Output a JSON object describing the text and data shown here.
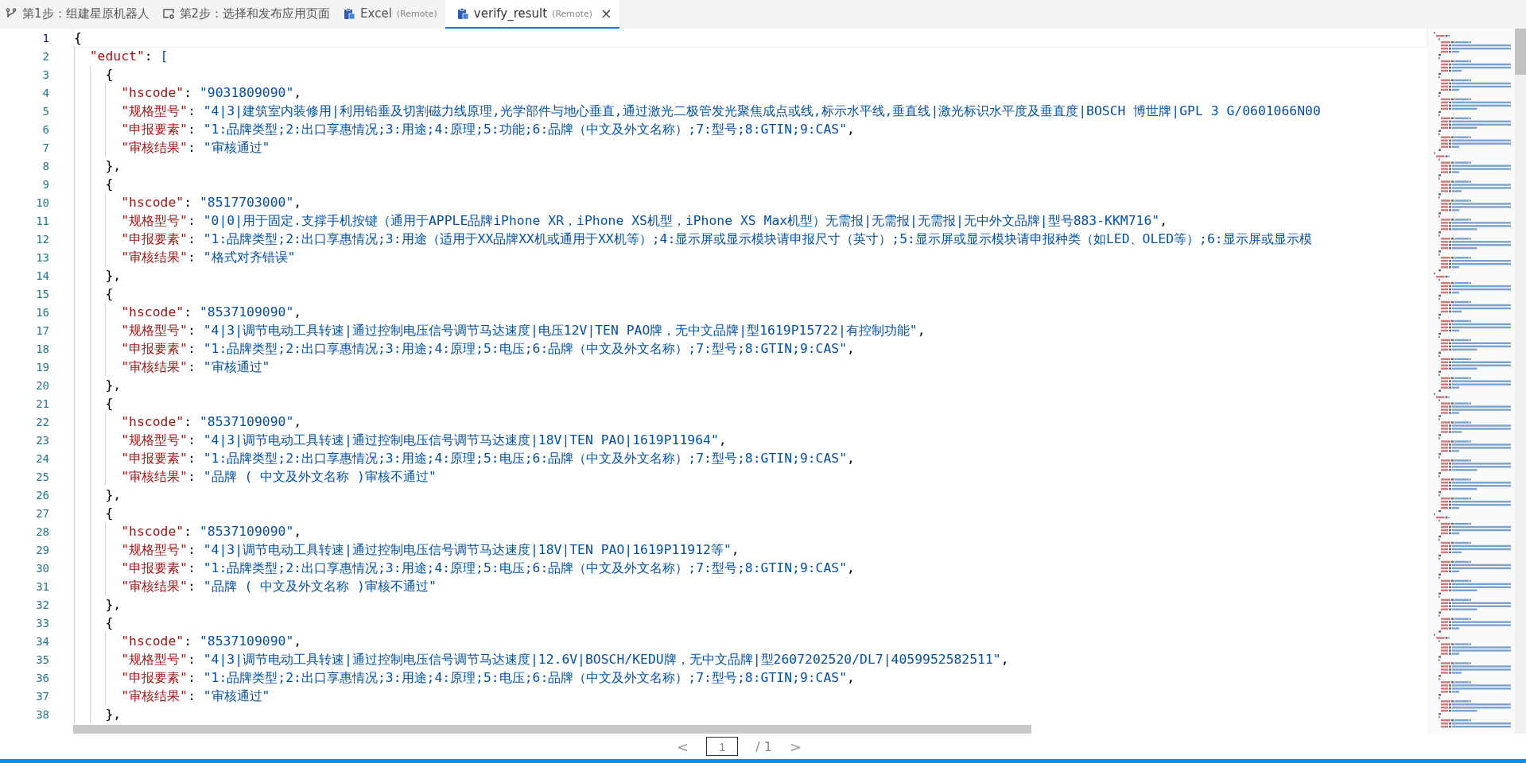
{
  "tabs": [
    {
      "label": "第1步：组建星原机器人",
      "selected": false
    },
    {
      "label": "第2步：选择和发布应用页面",
      "selected": false
    },
    {
      "label": "Excel",
      "suffix": "(Remote)",
      "selected": false
    },
    {
      "label": "verify_result",
      "suffix": "(Remote)",
      "selected": true,
      "close": "×"
    }
  ],
  "editor": {
    "lines": [
      {
        "number": "1",
        "active": true,
        "tokens": [
          {
            "kind": "punct",
            "text": "{"
          }
        ]
      },
      {
        "number": "2",
        "active": false,
        "tokens": [
          {
            "kind": "key",
            "text": "\"educt\""
          },
          {
            "kind": "punct",
            "text": ": "
          },
          {
            "kind": "str",
            "text": "["
          }
        ]
      },
      {
        "number": "3",
        "active": false,
        "tokens": [
          {
            "kind": "punct",
            "text": "{"
          }
        ]
      },
      {
        "number": "4",
        "active": false,
        "tokens": [
          {
            "kind": "key",
            "text": "\"hscode\""
          },
          {
            "kind": "punct",
            "text": ": "
          },
          {
            "kind": "str",
            "text": "\"9031809090\""
          },
          {
            "kind": "punct",
            "text": ","
          }
        ]
      },
      {
        "number": "5",
        "active": false,
        "tokens": [
          {
            "kind": "key",
            "text": "\"规格型号\""
          },
          {
            "kind": "punct",
            "text": ": "
          },
          {
            "kind": "str",
            "text": "\"4|3|建筑室内装修用|利用铅垂及切割磁力线原理,光学部件与地心垂直,通过激光二极管发光聚焦成点或线,标示水平线,垂直线|激光标识水平度及垂直度|BOSCH 博世牌|GPL 3 G/0601066N00"
          }
        ]
      },
      {
        "number": "6",
        "active": false,
        "tokens": [
          {
            "kind": "key",
            "text": "\"申报要素\""
          },
          {
            "kind": "punct",
            "text": ": "
          },
          {
            "kind": "str",
            "text": "\"1:品牌类型;2:出口享惠情况;3:用途;4:原理;5:功能;6:品牌（中文及外文名称）;7:型号;8:GTIN;9:CAS\""
          },
          {
            "kind": "punct",
            "text": ","
          }
        ]
      },
      {
        "number": "7",
        "active": false,
        "tokens": [
          {
            "kind": "key",
            "text": "\"审核结果\""
          },
          {
            "kind": "punct",
            "text": ": "
          },
          {
            "kind": "str",
            "text": "\"审核通过\""
          }
        ]
      },
      {
        "number": "8",
        "active": false,
        "tokens": [
          {
            "kind": "punct",
            "text": "},"
          }
        ]
      },
      {
        "number": "9",
        "active": false,
        "tokens": [
          {
            "kind": "punct",
            "text": "{"
          }
        ]
      },
      {
        "number": "10",
        "active": false,
        "tokens": [
          {
            "kind": "key",
            "text": "\"hscode\""
          },
          {
            "kind": "punct",
            "text": ": "
          },
          {
            "kind": "str",
            "text": "\"8517703000\""
          },
          {
            "kind": "punct",
            "text": ","
          }
        ]
      },
      {
        "number": "11",
        "active": false,
        "tokens": [
          {
            "kind": "key",
            "text": "\"规格型号\""
          },
          {
            "kind": "punct",
            "text": ": "
          },
          {
            "kind": "str",
            "text": "\"0|0|用于固定.支撑手机按键（通用于APPLE品牌iPhone XR，iPhone XS机型，iPhone XS Max机型）无需报|无需报|无需报|无中外文品牌|型号883-KKM716\""
          },
          {
            "kind": "punct",
            "text": ","
          }
        ]
      },
      {
        "number": "12",
        "active": false,
        "tokens": [
          {
            "kind": "key",
            "text": "\"申报要素\""
          },
          {
            "kind": "punct",
            "text": ": "
          },
          {
            "kind": "str",
            "text": "\"1:品牌类型;2:出口享惠情况;3:用途（适用于XX品牌XX机或通用于XX机等）;4:显示屏或显示模块请申报尺寸（英寸）;5:显示屏或显示模块请申报种类（如LED、OLED等）;6:显示屏或显示模"
          }
        ]
      },
      {
        "number": "13",
        "active": false,
        "tokens": [
          {
            "kind": "key",
            "text": "\"审核结果\""
          },
          {
            "kind": "punct",
            "text": ": "
          },
          {
            "kind": "str",
            "text": "\"格式对齐错误\""
          }
        ]
      },
      {
        "number": "14",
        "active": false,
        "tokens": [
          {
            "kind": "punct",
            "text": "},"
          }
        ]
      },
      {
        "number": "15",
        "active": false,
        "tokens": [
          {
            "kind": "punct",
            "text": "{"
          }
        ]
      },
      {
        "number": "16",
        "active": false,
        "tokens": [
          {
            "kind": "key",
            "text": "\"hscode\""
          },
          {
            "kind": "punct",
            "text": ": "
          },
          {
            "kind": "str",
            "text": "\"8537109090\""
          },
          {
            "kind": "punct",
            "text": ","
          }
        ]
      },
      {
        "number": "17",
        "active": false,
        "tokens": [
          {
            "kind": "key",
            "text": "\"规格型号\""
          },
          {
            "kind": "punct",
            "text": ": "
          },
          {
            "kind": "str",
            "text": "\"4|3|调节电动工具转速|通过控制电压信号调节马达速度|电压12V|TEN PAO牌，无中文品牌|型1619P15722|有控制功能\""
          },
          {
            "kind": "punct",
            "text": ","
          }
        ]
      },
      {
        "number": "18",
        "active": false,
        "tokens": [
          {
            "kind": "key",
            "text": "\"申报要素\""
          },
          {
            "kind": "punct",
            "text": ": "
          },
          {
            "kind": "str",
            "text": "\"1:品牌类型;2:出口享惠情况;3:用途;4:原理;5:电压;6:品牌（中文及外文名称）;7:型号;8:GTIN;9:CAS\""
          },
          {
            "kind": "punct",
            "text": ","
          }
        ]
      },
      {
        "number": "19",
        "active": false,
        "tokens": [
          {
            "kind": "key",
            "text": "\"审核结果\""
          },
          {
            "kind": "punct",
            "text": ": "
          },
          {
            "kind": "str",
            "text": "\"审核通过\""
          }
        ]
      },
      {
        "number": "20",
        "active": false,
        "tokens": [
          {
            "kind": "punct",
            "text": "},"
          }
        ]
      },
      {
        "number": "21",
        "active": false,
        "tokens": [
          {
            "kind": "punct",
            "text": "{"
          }
        ]
      },
      {
        "number": "22",
        "active": false,
        "tokens": [
          {
            "kind": "key",
            "text": "\"hscode\""
          },
          {
            "kind": "punct",
            "text": ": "
          },
          {
            "kind": "str",
            "text": "\"8537109090\""
          },
          {
            "kind": "punct",
            "text": ","
          }
        ]
      },
      {
        "number": "23",
        "active": false,
        "tokens": [
          {
            "kind": "key",
            "text": "\"规格型号\""
          },
          {
            "kind": "punct",
            "text": ": "
          },
          {
            "kind": "str",
            "text": "\"4|3|调节电动工具转速|通过控制电压信号调节马达速度|18V|TEN PAO|1619P11964\""
          },
          {
            "kind": "punct",
            "text": ","
          }
        ]
      },
      {
        "number": "24",
        "active": false,
        "tokens": [
          {
            "kind": "key",
            "text": "\"申报要素\""
          },
          {
            "kind": "punct",
            "text": ": "
          },
          {
            "kind": "str",
            "text": "\"1:品牌类型;2:出口享惠情况;3:用途;4:原理;5:电压;6:品牌（中文及外文名称）;7:型号;8:GTIN;9:CAS\""
          },
          {
            "kind": "punct",
            "text": ","
          }
        ]
      },
      {
        "number": "25",
        "active": false,
        "tokens": [
          {
            "kind": "key",
            "text": "\"审核结果\""
          },
          {
            "kind": "punct",
            "text": ": "
          },
          {
            "kind": "str",
            "text": "\"品牌 ( 中文及外文名称 )审核不通过\""
          }
        ]
      },
      {
        "number": "26",
        "active": false,
        "tokens": [
          {
            "kind": "punct",
            "text": "},"
          }
        ]
      },
      {
        "number": "27",
        "active": false,
        "tokens": [
          {
            "kind": "punct",
            "text": "{"
          }
        ]
      },
      {
        "number": "28",
        "active": false,
        "tokens": [
          {
            "kind": "key",
            "text": "\"hscode\""
          },
          {
            "kind": "punct",
            "text": ": "
          },
          {
            "kind": "str",
            "text": "\"8537109090\""
          },
          {
            "kind": "punct",
            "text": ","
          }
        ]
      },
      {
        "number": "29",
        "active": false,
        "tokens": [
          {
            "kind": "key",
            "text": "\"规格型号\""
          },
          {
            "kind": "punct",
            "text": ": "
          },
          {
            "kind": "str",
            "text": "\"4|3|调节电动工具转速|通过控制电压信号调节马达速度|18V|TEN PAO|1619P11912等\""
          },
          {
            "kind": "punct",
            "text": ","
          }
        ]
      },
      {
        "number": "30",
        "active": false,
        "tokens": [
          {
            "kind": "key",
            "text": "\"申报要素\""
          },
          {
            "kind": "punct",
            "text": ": "
          },
          {
            "kind": "str",
            "text": "\"1:品牌类型;2:出口享惠情况;3:用途;4:原理;5:电压;6:品牌（中文及外文名称）;7:型号;8:GTIN;9:CAS\""
          },
          {
            "kind": "punct",
            "text": ","
          }
        ]
      },
      {
        "number": "31",
        "active": false,
        "tokens": [
          {
            "kind": "key",
            "text": "\"审核结果\""
          },
          {
            "kind": "punct",
            "text": ": "
          },
          {
            "kind": "str",
            "text": "\"品牌 ( 中文及外文名称 )审核不通过\""
          }
        ]
      },
      {
        "number": "32",
        "active": false,
        "tokens": [
          {
            "kind": "punct",
            "text": "},"
          }
        ]
      },
      {
        "number": "33",
        "active": false,
        "tokens": [
          {
            "kind": "punct",
            "text": "{"
          }
        ]
      },
      {
        "number": "34",
        "active": false,
        "tokens": [
          {
            "kind": "key",
            "text": "\"hscode\""
          },
          {
            "kind": "punct",
            "text": ": "
          },
          {
            "kind": "str",
            "text": "\"8537109090\""
          },
          {
            "kind": "punct",
            "text": ","
          }
        ]
      },
      {
        "number": "35",
        "active": false,
        "tokens": [
          {
            "kind": "key",
            "text": "\"规格型号\""
          },
          {
            "kind": "punct",
            "text": ": "
          },
          {
            "kind": "str",
            "text": "\"4|3|调节电动工具转速|通过控制电压信号调节马达速度|12.6V|BOSCH/KEDU牌，无中文品牌|型2607202520/DL7|4059952582511\""
          },
          {
            "kind": "punct",
            "text": ","
          }
        ]
      },
      {
        "number": "36",
        "active": false,
        "tokens": [
          {
            "kind": "key",
            "text": "\"申报要素\""
          },
          {
            "kind": "punct",
            "text": ": "
          },
          {
            "kind": "str",
            "text": "\"1:品牌类型;2:出口享惠情况;3:用途;4:原理;5:电压;6:品牌（中文及外文名称）;7:型号;8:GTIN;9:CAS\""
          },
          {
            "kind": "punct",
            "text": ","
          }
        ]
      },
      {
        "number": "37",
        "active": false,
        "tokens": [
          {
            "kind": "key",
            "text": "\"审核结果\""
          },
          {
            "kind": "punct",
            "text": ": "
          },
          {
            "kind": "str",
            "text": "\"审核通过\""
          }
        ]
      },
      {
        "number": "38",
        "active": false,
        "tokens": [
          {
            "kind": "punct",
            "text": "},"
          }
        ]
      }
    ]
  },
  "pager": {
    "prev": "<",
    "page": "1",
    "total": "/ 1",
    "next": ">"
  }
}
